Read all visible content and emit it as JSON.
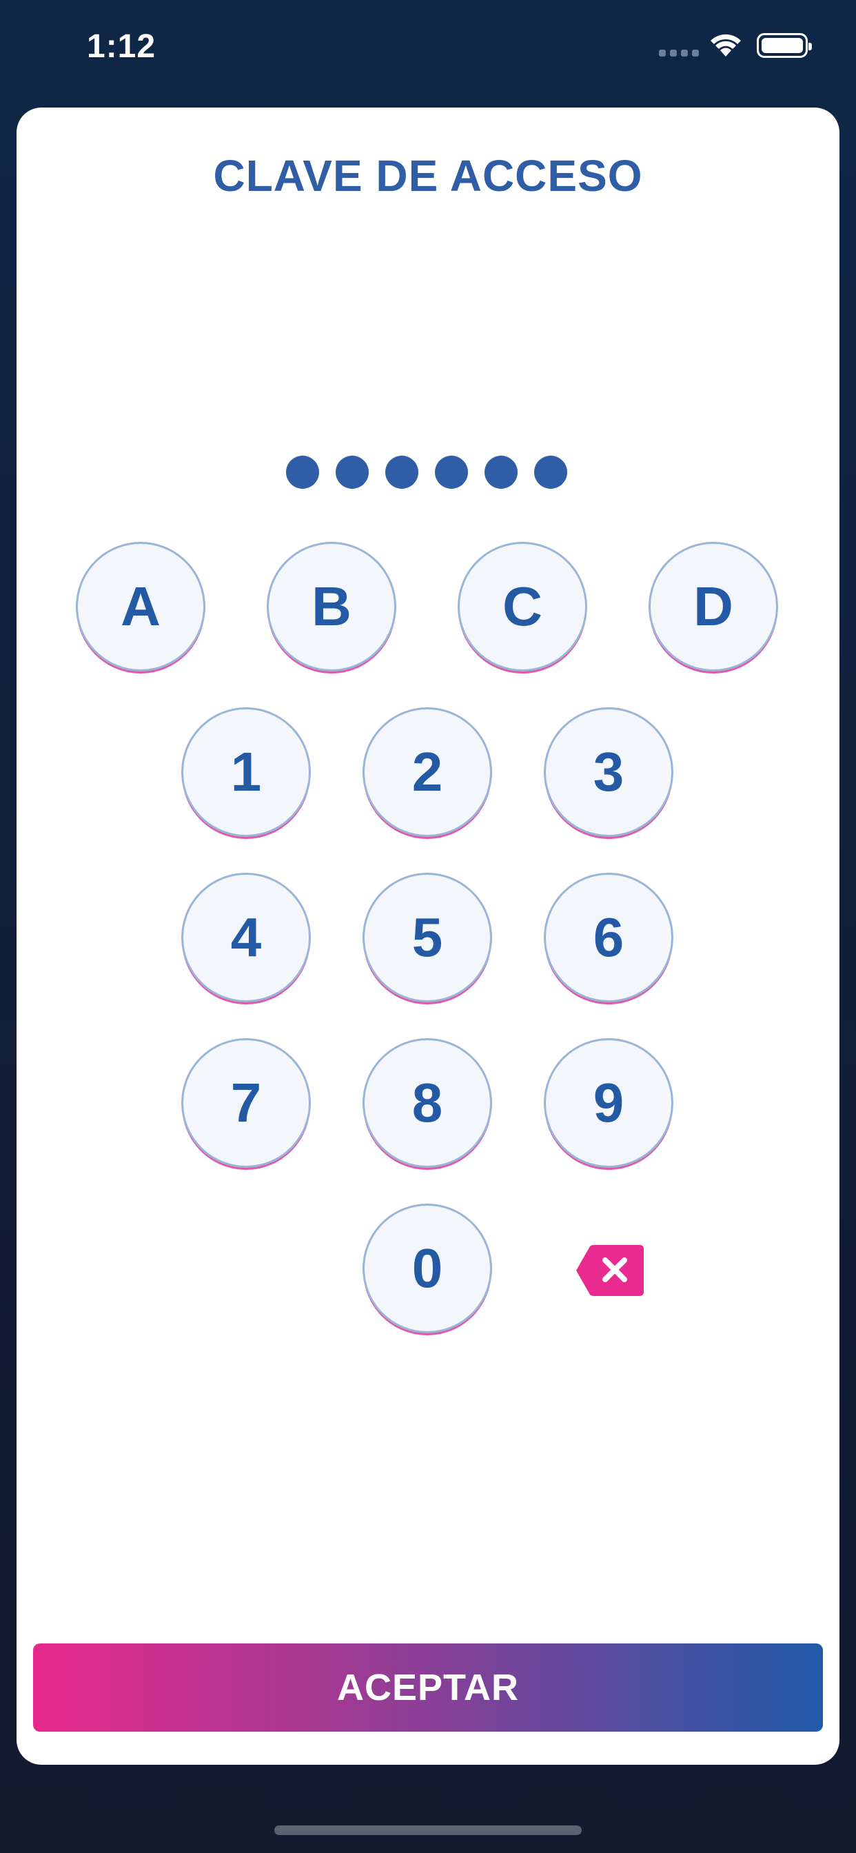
{
  "status_bar": {
    "time": "1:12"
  },
  "screen": {
    "title": "CLAVE DE ACCESO"
  },
  "pin": {
    "entered_count": 6
  },
  "keypad": {
    "letters": [
      "A",
      "B",
      "C",
      "D"
    ],
    "digits": [
      "1",
      "2",
      "3",
      "4",
      "5",
      "6",
      "7",
      "8",
      "9",
      "0"
    ],
    "delete_icon": "backspace-x-icon"
  },
  "actions": {
    "accept_label": "ACEPTAR"
  },
  "colors": {
    "background": "#0f2747",
    "card": "#ffffff",
    "primary_blue": "#2f5ea6",
    "accent_pink": "#e92a8e",
    "key_fill": "#f3f6fb"
  }
}
